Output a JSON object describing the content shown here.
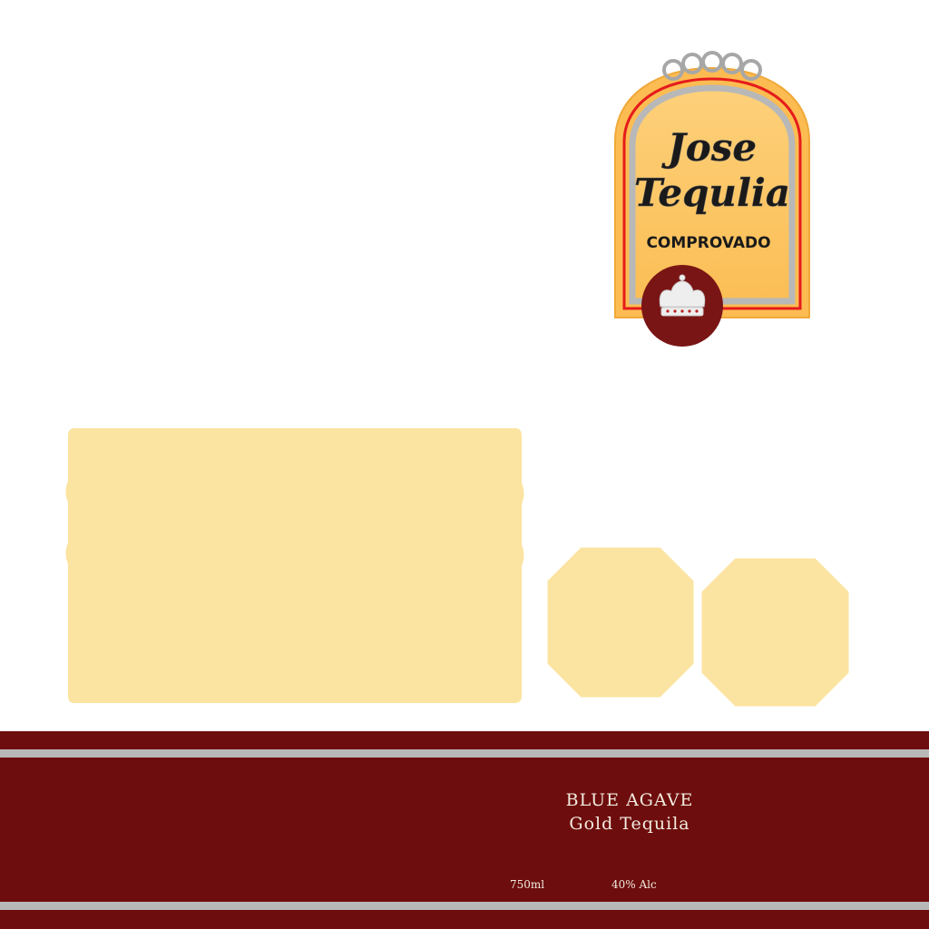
{
  "logo": {
    "line1": "Jose",
    "line2": "Tequlia",
    "tagline": "COMPROVADO",
    "emblem_icon": "crown-icon"
  },
  "band": {
    "line1": "BLUE AGAVE",
    "line2": "Gold Tequila",
    "volume": "750ml",
    "abv": "40% Alc"
  },
  "colors": {
    "band": "#6e0d0d",
    "stripe": "#b8b8b8",
    "panel": "#fbe4a1",
    "logo_gold": "#fcbc52",
    "logo_red": "#e51b1b",
    "logo_silver": "#b8b8b8"
  }
}
